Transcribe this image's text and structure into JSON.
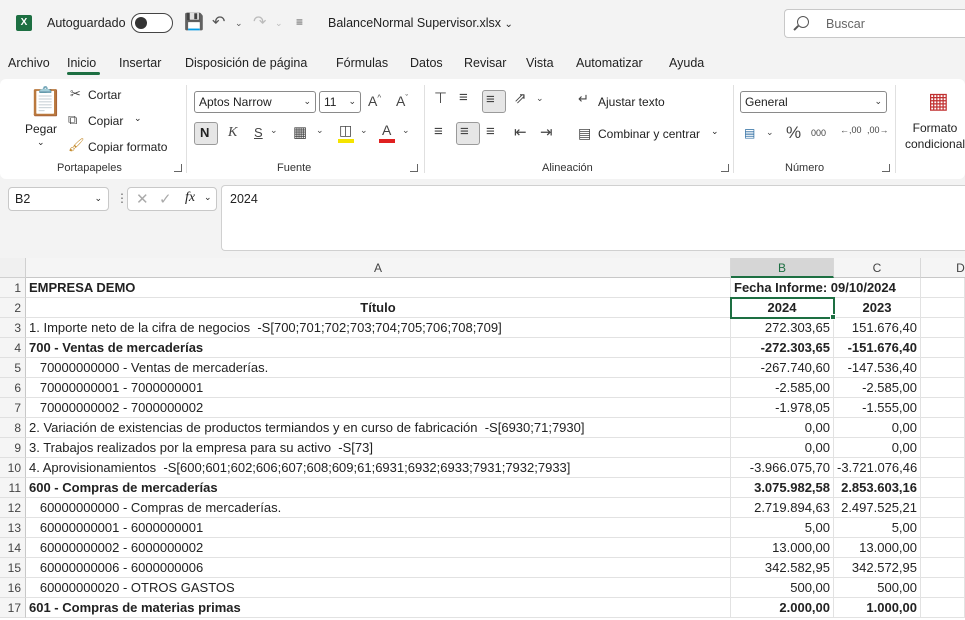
{
  "titlebar": {
    "app_icon": "excel-icon",
    "autosave_label": "Autoguardado",
    "autosave_on": false,
    "filename": "BalanceNormal Supervisor.xlsx",
    "search_placeholder": "Buscar"
  },
  "menu": {
    "items": [
      "Archivo",
      "Inicio",
      "Insertar",
      "Disposición de página",
      "Fórmulas",
      "Datos",
      "Revisar",
      "Vista",
      "Automatizar",
      "Ayuda"
    ],
    "active": "Inicio"
  },
  "ribbon": {
    "portapapeles": {
      "label": "Portapapeles",
      "paste": "Pegar",
      "cut": "Cortar",
      "copy": "Copiar",
      "format_painter": "Copiar formato"
    },
    "fuente": {
      "label": "Fuente",
      "font_name": "Aptos Narrow",
      "font_size": "11",
      "bold": "N",
      "italic": "K",
      "underline": "S",
      "grow": "A^",
      "shrink": "A˅",
      "font_color_letter": "A"
    },
    "alineacion": {
      "label": "Alineación",
      "wrap_text": "Ajustar texto",
      "merge_center": "Combinar y centrar"
    },
    "numero": {
      "label": "Número",
      "format": "General",
      "percent": "%",
      "thousands": "000",
      "inc_decimal": ",00",
      "dec_decimal": ",00"
    },
    "estilos": {
      "conditional_format": "Formato condicional"
    }
  },
  "formula_bar": {
    "name_box": "B2",
    "fx": "fx",
    "value": "2024"
  },
  "grid": {
    "columns": [
      "A",
      "B",
      "C",
      "D"
    ],
    "selected_column": "B",
    "rows": [
      {
        "n": "1",
        "a": "EMPRESA DEMO",
        "b": "Fecha Informe: 09/10/2024",
        "c": "",
        "bold": true,
        "merged_bc": true
      },
      {
        "n": "2",
        "a": "Título",
        "b": "2024",
        "c": "2023",
        "bold": true,
        "center": true
      },
      {
        "n": "3",
        "a": "1. Importe neto de la cifra de negocios  -S[700;701;702;703;704;705;706;708;709]",
        "b": "272.303,65",
        "c": "151.676,40",
        "bold": false
      },
      {
        "n": "4",
        "a": "700 - Ventas de mercaderías",
        "b": "-272.303,65",
        "c": "-151.676,40",
        "bold": true
      },
      {
        "n": "5",
        "a": "   70000000000 - Ventas de mercaderías.",
        "b": "-267.740,60",
        "c": "-147.536,40",
        "bold": false
      },
      {
        "n": "6",
        "a": "   70000000001 - 7000000001",
        "b": "-2.585,00",
        "c": "-2.585,00",
        "bold": false
      },
      {
        "n": "7",
        "a": "   70000000002 - 7000000002",
        "b": "-1.978,05",
        "c": "-1.555,00",
        "bold": false
      },
      {
        "n": "8",
        "a": "2. Variación de existencias de productos termiandos y en curso de fabricación  -S[6930;71;7930]",
        "b": "0,00",
        "c": "0,00",
        "bold": false
      },
      {
        "n": "9",
        "a": "3. Trabajos realizados por la empresa para su activo  -S[73]",
        "b": "0,00",
        "c": "0,00",
        "bold": false
      },
      {
        "n": "10",
        "a": "4. Aprovisionamientos  -S[600;601;602;606;607;608;609;61;6931;6932;6933;7931;7932;7933]",
        "b": "-3.966.075,70",
        "c": "-3.721.076,46",
        "bold": false
      },
      {
        "n": "11",
        "a": "600 - Compras de mercaderías",
        "b": "3.075.982,58",
        "c": "2.853.603,16",
        "bold": true
      },
      {
        "n": "12",
        "a": "   60000000000 - Compras de mercaderías.",
        "b": "2.719.894,63",
        "c": "2.497.525,21",
        "bold": false
      },
      {
        "n": "13",
        "a": "   60000000001 - 6000000001",
        "b": "5,00",
        "c": "5,00",
        "bold": false
      },
      {
        "n": "14",
        "a": "   60000000002 - 6000000002",
        "b": "13.000,00",
        "c": "13.000,00",
        "bold": false
      },
      {
        "n": "15",
        "a": "   60000000006 - 6000000006",
        "b": "342.582,95",
        "c": "342.572,95",
        "bold": false
      },
      {
        "n": "16",
        "a": "   60000000020 - OTROS GASTOS",
        "b": "500,00",
        "c": "500,00",
        "bold": false
      },
      {
        "n": "17",
        "a": "601 - Compras de materias primas",
        "b": "2.000,00",
        "c": "1.000,00",
        "bold": true
      }
    ]
  }
}
